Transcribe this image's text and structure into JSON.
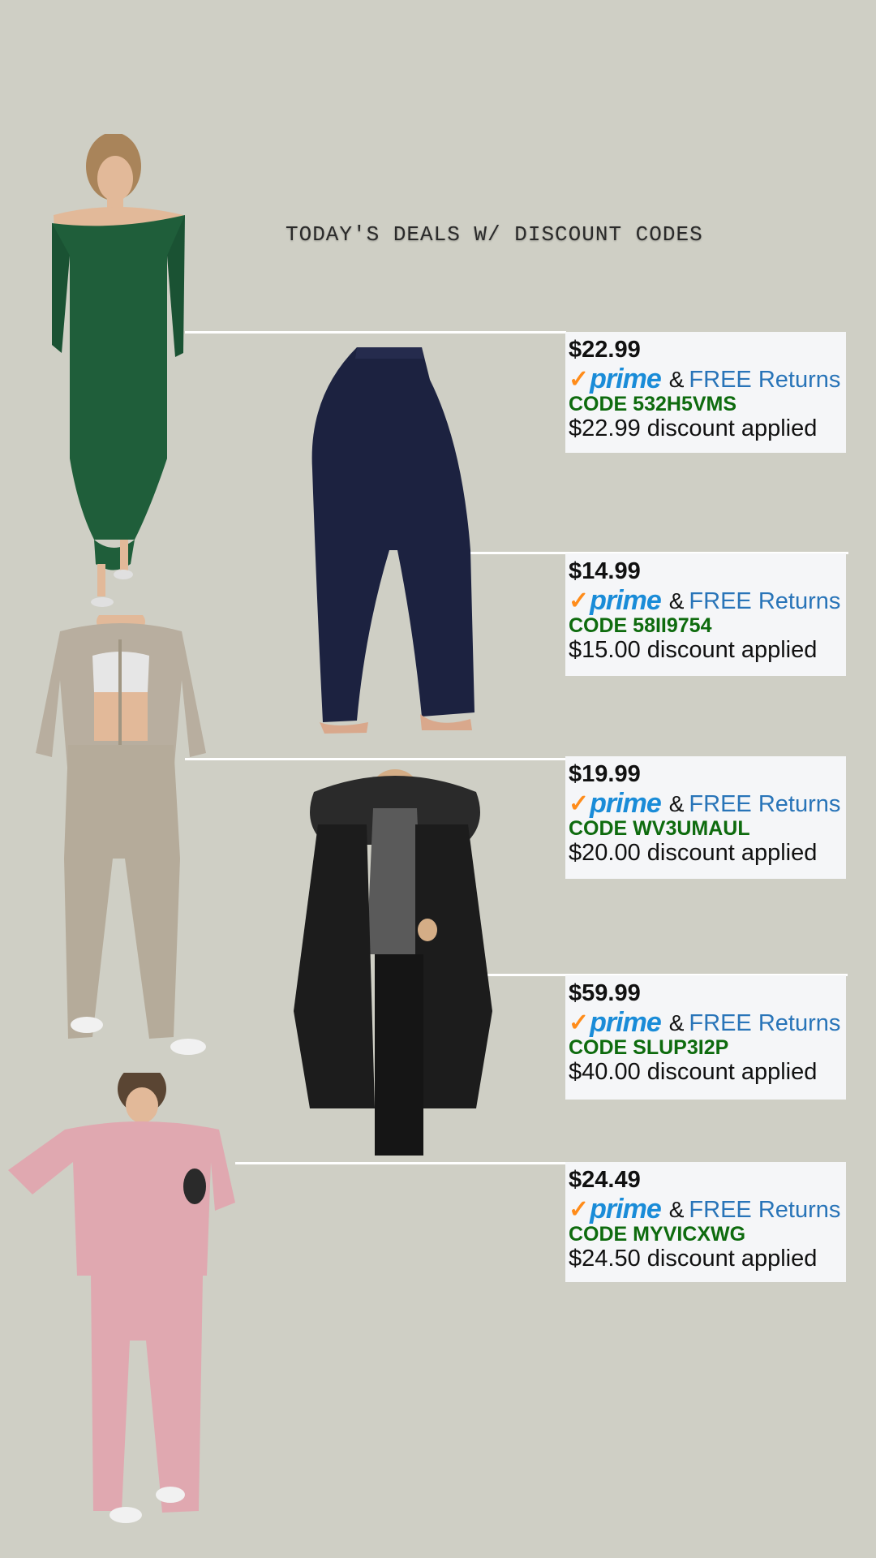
{
  "header": {
    "title": "TODAY'S DEALS W/ DISCOUNT CODES"
  },
  "colors": {
    "background": "#cfcfc5",
    "prime_blue": "#1a8cd8",
    "check_orange": "#ff8c1a",
    "code_green": "#0e6b0e",
    "returns_blue": "#2874b8"
  },
  "products": [
    {
      "name": "green-ribbed-off-shoulder-dress",
      "color": "#1f5e3a"
    },
    {
      "name": "navy-flare-leggings",
      "color": "#1c2240"
    },
    {
      "name": "taupe-zip-sweatshirt-set",
      "color": "#b8ae9f"
    },
    {
      "name": "black-puffer-coat-fur-hood",
      "color": "#1c1c1c"
    },
    {
      "name": "pink-oversized-sweatshirt-set",
      "color": "#e0a8b0"
    }
  ],
  "deals": [
    {
      "price": "$22.99",
      "prime": "prime",
      "amp": "&",
      "returns": "FREE Returns",
      "code": "CODE 532H5VMS",
      "applied": "$22.99 discount applied"
    },
    {
      "price": "$14.99",
      "prime": "prime",
      "amp": "&",
      "returns": "FREE Returns",
      "code": "CODE 58II9754",
      "applied": "$15.00 discount applied"
    },
    {
      "price": "$19.99",
      "prime": "prime",
      "amp": "&",
      "returns": "FREE Returns",
      "code": "CODE WV3UMAUL",
      "applied": "$20.00 discount applied"
    },
    {
      "price": "$59.99",
      "prime": "prime",
      "amp": "&",
      "returns": "FREE Returns",
      "code": "CODE SLUP3I2P",
      "applied": "$40.00 discount applied"
    },
    {
      "price": "$24.49",
      "prime": "prime",
      "amp": "&",
      "returns": "FREE Returns",
      "code": "CODE MYVICXWG",
      "applied": "$24.50 discount applied"
    }
  ]
}
